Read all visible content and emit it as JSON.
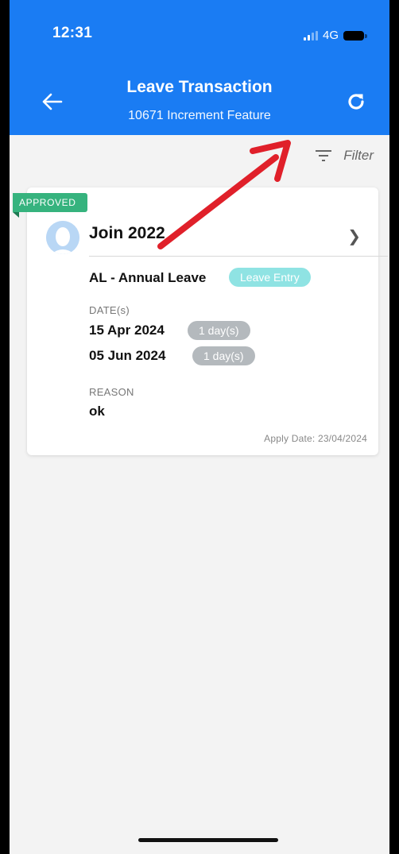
{
  "status_bar": {
    "time": "12:31",
    "network": "4G"
  },
  "header": {
    "title": "Leave Transaction",
    "subtitle": "10671 Increment Feature",
    "back_icon": "arrow-left-icon",
    "refresh_icon": "refresh-icon",
    "color": "#1a7cf3"
  },
  "filter": {
    "label": "Filter",
    "icon": "filter-lines-icon"
  },
  "card": {
    "status_badge": "APPROVED",
    "status_color": "#36b37e",
    "name": "Join 2022",
    "leave_type": "AL - Annual Leave",
    "entry_type": "Leave Entry",
    "dates_label": "DATE(s)",
    "dates": [
      {
        "date": "15 Apr 2024",
        "duration": "1 day(s)"
      },
      {
        "date": "05 Jun 2024",
        "duration": "1 day(s)"
      }
    ],
    "reason_label": "REASON",
    "reason": "ok",
    "apply_date": "Apply Date: 23/04/2024"
  },
  "annotation": {
    "type": "red-arrow",
    "color": "#e0202a"
  }
}
